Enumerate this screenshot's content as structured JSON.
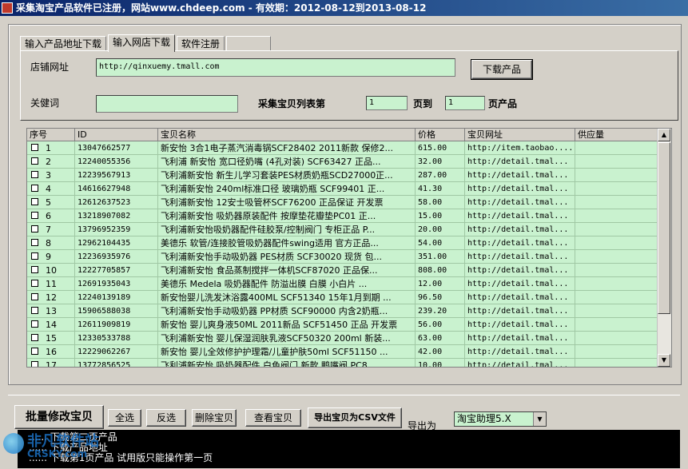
{
  "window": {
    "title": "采集淘宝产品软件已注册，网站www.chdeep.com - 有效期：2012-08-12到2013-08-12"
  },
  "tabs": [
    {
      "label": "输入产品地址下载"
    },
    {
      "label": "输入网店下载"
    },
    {
      "label": "软件注册"
    }
  ],
  "shop_panel": {
    "shop_url_label": "店铺网址",
    "shop_url_value": "http://qinxuemy.tmall.com",
    "download_button": "下载产品",
    "keyword_label": "关健词",
    "keyword_value": "",
    "page_label_prefix": "采集宝贝列表第",
    "page_from": "1",
    "page_label_mid": "页到",
    "page_to": "1",
    "page_label_suffix": "页产品"
  },
  "table": {
    "columns": [
      "序号",
      "ID",
      "宝贝名称",
      "价格",
      "宝贝网址",
      "供应量"
    ],
    "rows": [
      {
        "no": "1",
        "id": "13047662577",
        "name": "新安怡 3合1电子蒸汽消毒锅SCF28402 2011新款 保修2...",
        "price": "615.00",
        "url": "http://item.taobao...."
      },
      {
        "no": "2",
        "id": "12240055356",
        "name": "飞利浦 新安怡 宽口径奶嘴 (4孔对装) SCF63427 正品...",
        "price": "32.00",
        "url": "http://detail.tmal..."
      },
      {
        "no": "3",
        "id": "12239567913",
        "name": "飞利浦新安怡 新生儿学习套装PES材质奶瓶SCD27000正...",
        "price": "287.00",
        "url": "http://detail.tmal..."
      },
      {
        "no": "4",
        "id": "14616627948",
        "name": "飞利浦新安怡 240ml标准口径 玻璃奶瓶 SCF99401 正...",
        "price": "41.30",
        "url": "http://detail.tmal..."
      },
      {
        "no": "5",
        "id": "12612637523",
        "name": "飞利浦新安怡 12安士吸管杯SCF76200 正品保证 开发票",
        "price": "58.00",
        "url": "http://detail.tmal..."
      },
      {
        "no": "6",
        "id": "13218907082",
        "name": "飞利浦新安怡 吸奶器原装配件 按摩垫花瓣垫PC01 正...",
        "price": "15.00",
        "url": "http://detail.tmal..."
      },
      {
        "no": "7",
        "id": "13796952359",
        "name": "飞利浦新安怡吸奶器配件硅胶泵/控制阀门 专柜正品 P...",
        "price": "20.00",
        "url": "http://detail.tmal..."
      },
      {
        "no": "8",
        "id": "12962104435",
        "name": "美德乐 软管/连接胶管吸奶器配件swing适用 官方正品...",
        "price": "54.00",
        "url": "http://detail.tmal..."
      },
      {
        "no": "9",
        "id": "12236935976",
        "name": "飞利浦新安怡手动吸奶器 PES材质 SCF30020 现货 包...",
        "price": "351.00",
        "url": "http://detail.tmal..."
      },
      {
        "no": "10",
        "id": "12227705857",
        "name": "飞利浦新安怡 食品蒸制搅拌一体机SCF87020 正品保...",
        "price": "808.00",
        "url": "http://detail.tmal..."
      },
      {
        "no": "11",
        "id": "12691935043",
        "name": "美德乐 Medela 吸奶器配件 防溢出膜 白膜 小白片 ...",
        "price": "12.00",
        "url": "http://detail.tmal..."
      },
      {
        "no": "12",
        "id": "12240139189",
        "name": "新安怡婴儿洗发沐浴露400ML SCF51340 15年1月到期 ...",
        "price": "96.50",
        "url": "http://detail.tmal..."
      },
      {
        "no": "13",
        "id": "15906588038",
        "name": "飞利浦新安怡手动吸奶器 PP材质 SCF90000 内含2奶瓶...",
        "price": "239.20",
        "url": "http://detail.tmal..."
      },
      {
        "no": "14",
        "id": "12611909819",
        "name": "新安怡 婴儿爽身液50ML 2011新品 SCF51450 正品 开发票",
        "price": "56.00",
        "url": "http://detail.tmal..."
      },
      {
        "no": "15",
        "id": "12330533788",
        "name": "飞利浦新安怡 婴儿保湿润肤乳液SCF50320 200ml 新装...",
        "price": "63.00",
        "url": "http://detail.tmal..."
      },
      {
        "no": "16",
        "id": "12229062267",
        "name": "新安怡 婴儿全效修护护理霜/儿童护肤50ml SCF51150 ...",
        "price": "42.00",
        "url": "http://detail.tmal..."
      },
      {
        "no": "17",
        "id": "13772856525",
        "name": "飞利浦新安怡 吸奶器配件 白色阀门 新款 鸭嘴阀 PC8...",
        "price": "10.00",
        "url": "http://detail.tmal..."
      }
    ]
  },
  "bottom": {
    "group_label": "批量修改宝贝",
    "select_all": "全选",
    "invert": "反选",
    "delete": "删除宝贝",
    "view": "查看宝贝",
    "export_csv": "导出宝贝为CSV文件",
    "export_as_label": "导出为",
    "export_target": "淘宝助理5.X"
  },
  "log": [
    "...... 下载第二页产品",
    "...... 下载产品地址",
    "...... 下载第1页产品 试用版只能操作第一页"
  ],
  "watermark": {
    "text": "非凡软件站",
    "sub": "CRSKY.com"
  }
}
